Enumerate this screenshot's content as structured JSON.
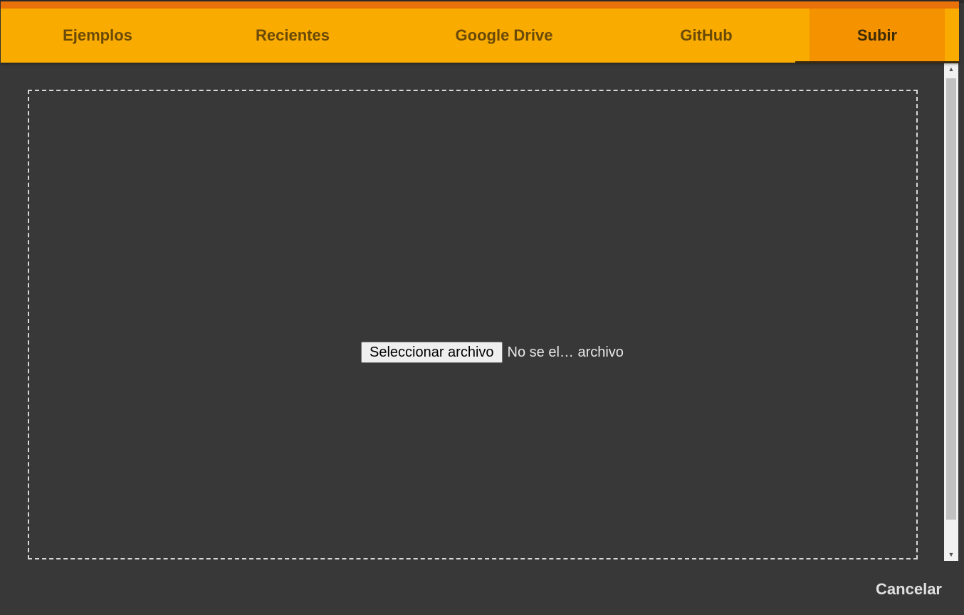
{
  "tabs": [
    {
      "label": "Ejemplos",
      "active": false
    },
    {
      "label": "Recientes",
      "active": false
    },
    {
      "label": "Google Drive",
      "active": false
    },
    {
      "label": "GitHub",
      "active": false
    },
    {
      "label": "Subir",
      "active": true
    }
  ],
  "upload": {
    "choose_button_label": "Seleccionar archivo",
    "file_status": "No se el… archivo"
  },
  "footer": {
    "cancel_label": "Cancelar"
  },
  "colors": {
    "header_background": "#f9ab00",
    "header_accent": "#e8710a",
    "active_tab_background": "#f59200",
    "dialog_background": "#383838"
  },
  "icons": {
    "scroll_up": "triangle-up-icon",
    "scroll_down": "triangle-down-icon"
  }
}
